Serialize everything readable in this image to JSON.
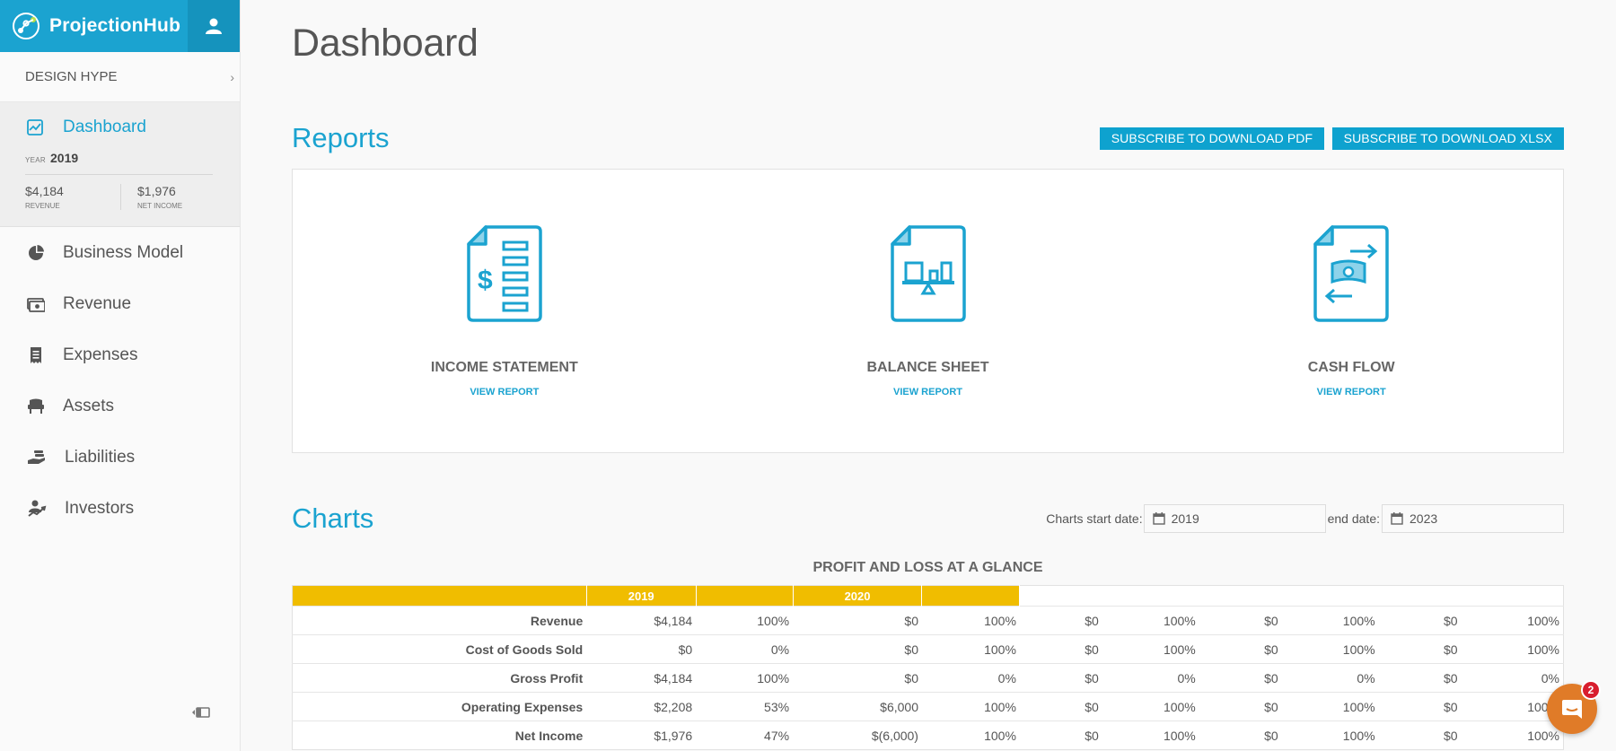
{
  "brand": {
    "name": "ProjectionHub"
  },
  "sidebar": {
    "company": "DESIGN HYPE",
    "active": {
      "label": "Dashboard",
      "year_label": "YEAR",
      "year": "2019",
      "revenue_value": "$4,184",
      "revenue_label": "REVENUE",
      "net_income_value": "$1,976",
      "net_income_label": "NET INCOME"
    },
    "items": [
      {
        "label": "Business Model",
        "icon": "pie-chart-icon"
      },
      {
        "label": "Revenue",
        "icon": "cash-icon"
      },
      {
        "label": "Expenses",
        "icon": "receipt-icon"
      },
      {
        "label": "Assets",
        "icon": "chair-icon"
      },
      {
        "label": "Liabilities",
        "icon": "hand-coins-icon"
      },
      {
        "label": "Investors",
        "icon": "investor-icon"
      }
    ]
  },
  "main": {
    "title": "Dashboard",
    "reports": {
      "title": "Reports",
      "pdf_button": "SUBSCRIBE TO DOWNLOAD PDF",
      "xlsx_button": "SUBSCRIBE TO DOWNLOAD XLSX",
      "cards": [
        {
          "title": "INCOME STATEMENT",
          "link": "VIEW REPORT",
          "icon": "income-statement-icon"
        },
        {
          "title": "BALANCE SHEET",
          "link": "VIEW REPORT",
          "icon": "balance-sheet-icon"
        },
        {
          "title": "CASH FLOW",
          "link": "VIEW REPORT",
          "icon": "cash-flow-icon"
        }
      ]
    },
    "charts": {
      "title": "Charts",
      "start_label": "Charts start date:",
      "start_value": "2019",
      "end_label": "end date:",
      "end_value": "2023"
    },
    "pl_table": {
      "title": "PROFIT AND LOSS AT A GLANCE",
      "headers": [
        "",
        "2019",
        "",
        "2020",
        ""
      ],
      "rows": [
        {
          "label": "Revenue",
          "cells": [
            "$4,184",
            "100%",
            "$0",
            "100%",
            "$0",
            "100%",
            "$0",
            "100%",
            "$0",
            "100%"
          ]
        },
        {
          "label": "Cost of Goods Sold",
          "cells": [
            "$0",
            "0%",
            "$0",
            "100%",
            "$0",
            "100%",
            "$0",
            "100%",
            "$0",
            "100%"
          ]
        },
        {
          "label": "Gross Profit",
          "cells": [
            "$4,184",
            "100%",
            "$0",
            "0%",
            "$0",
            "0%",
            "$0",
            "0%",
            "$0",
            "0%"
          ]
        },
        {
          "label": "Operating Expenses",
          "cells": [
            "$2,208",
            "53%",
            "$6,000",
            "100%",
            "$0",
            "100%",
            "$0",
            "100%",
            "$0",
            "100%"
          ]
        },
        {
          "label": "Net Income",
          "cells": [
            "$1,976",
            "47%",
            "$(6,000)",
            "100%",
            "$0",
            "100%",
            "$0",
            "100%",
            "$0",
            "100%"
          ]
        }
      ]
    }
  },
  "chat": {
    "badge": "2"
  },
  "colors": {
    "accent": "#1ba3d0",
    "gold": "#f0bd00",
    "chat": "#e07b28"
  }
}
